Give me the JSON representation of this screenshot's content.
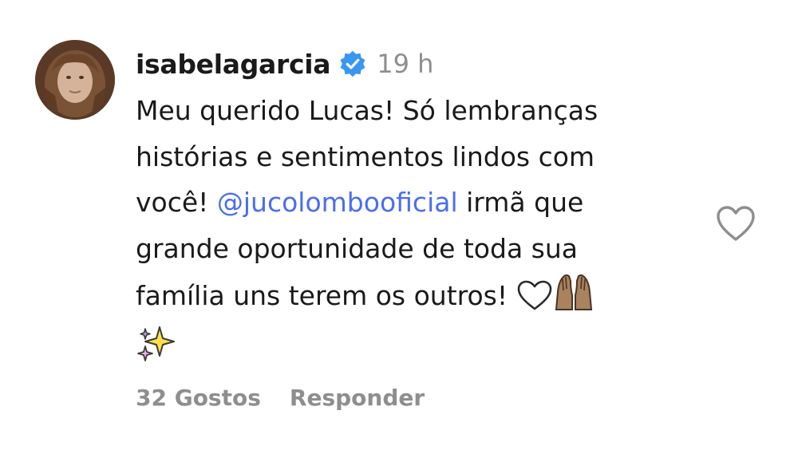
{
  "comment": {
    "username": "isabelagarcia",
    "time": "19 h",
    "text_line1": "Meu querido Lucas! Só lembranças",
    "text_line2": "histórias e sentimentos lindos com",
    "text_line3_pre": "você! ",
    "mention": "@jucolombooficial",
    "text_line3_post": " irmã que",
    "text_line4": "grande oportunidade de toda sua",
    "text_line5": "família uns terem os outros! ",
    "emojis": [
      "white-heart",
      "raised-hands",
      "sparkles"
    ],
    "likes_label": "32 Gostos",
    "reply_label": "Responder"
  },
  "colors": {
    "text": "#1a1a1a",
    "secondary": "#8e8e8e",
    "mention": "#4a6ef0",
    "verified": "#3897f0"
  },
  "icons": [
    "verified-badge-icon",
    "like-heart-icon"
  ]
}
